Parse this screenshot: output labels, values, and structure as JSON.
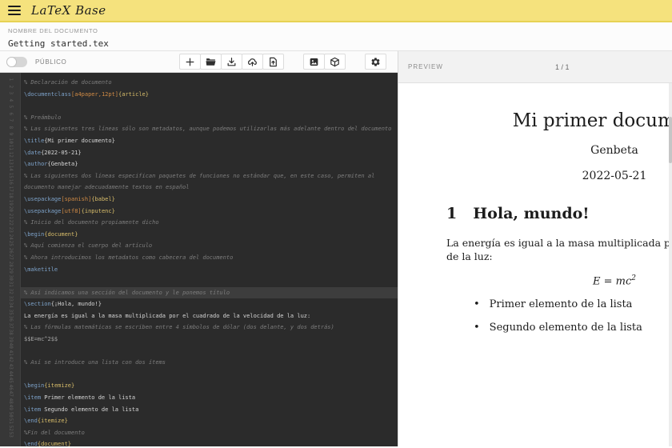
{
  "header": {
    "title": "LaTeX Base"
  },
  "document": {
    "name_label": "NOMBRE DEL DOCUMENTO",
    "name": "Getting started.tex"
  },
  "toolbar": {
    "public_label": "PÚBLICO",
    "public_enabled": false,
    "groups": [
      {
        "items": [
          {
            "name": "new-document",
            "icon": "plus-icon"
          },
          {
            "name": "open-document",
            "icon": "folder-open-icon"
          },
          {
            "name": "download",
            "icon": "download-icon"
          },
          {
            "name": "cloud-upload",
            "icon": "cloud-upload-icon"
          },
          {
            "name": "import-file",
            "icon": "file-upload-icon"
          }
        ]
      },
      {
        "items": [
          {
            "name": "insert-image",
            "icon": "image-icon"
          },
          {
            "name": "packages",
            "icon": "package-icon"
          }
        ]
      },
      {
        "items": [
          {
            "name": "settings",
            "icon": "gear-icon"
          }
        ]
      }
    ]
  },
  "editor": {
    "gutter_line_count": 53,
    "lines": [
      {
        "seg": [
          {
            "c": "comment",
            "t": "% Declaración de documento"
          }
        ]
      },
      {
        "seg": [
          {
            "c": "cmd",
            "t": "\\documentclass"
          },
          {
            "c": "opt",
            "t": "[a4paper,12pt]"
          },
          {
            "c": "env",
            "t": "{article}"
          }
        ]
      },
      {
        "seg": []
      },
      {
        "seg": [
          {
            "c": "comment",
            "t": "% Preámbulo"
          }
        ]
      },
      {
        "seg": [
          {
            "c": "comment",
            "t": "% Las siguientes tres líneas sólo son metadatos, aunque podemos utilizarlas más adelante dentro del documento"
          }
        ]
      },
      {
        "seg": [
          {
            "c": "cmd",
            "t": "\\title"
          },
          {
            "c": "txt",
            "t": "{Mi primer documento}"
          }
        ]
      },
      {
        "seg": [
          {
            "c": "cmd",
            "t": "\\date"
          },
          {
            "c": "txt",
            "t": "{2022-05-21}"
          }
        ]
      },
      {
        "seg": [
          {
            "c": "cmd",
            "t": "\\author"
          },
          {
            "c": "txt",
            "t": "{Genbeta}"
          }
        ]
      },
      {
        "wrap": true,
        "seg": [
          {
            "c": "comment",
            "t": "% Las siguientes dos líneas especifican paquetes de funciones no estándar que, en este caso, permiten al documento manejar adecuadamente textos en español"
          }
        ]
      },
      {
        "seg": [
          {
            "c": "cmd",
            "t": "\\usepackage"
          },
          {
            "c": "opt",
            "t": "[spanish]"
          },
          {
            "c": "env",
            "t": "{babel}"
          }
        ]
      },
      {
        "seg": [
          {
            "c": "cmd",
            "t": "\\usepackage"
          },
          {
            "c": "opt",
            "t": "[utf8]"
          },
          {
            "c": "env",
            "t": "{inputenc}"
          }
        ]
      },
      {
        "seg": [
          {
            "c": "comment",
            "t": "% Inicio del documento propiamente dicho"
          }
        ]
      },
      {
        "seg": [
          {
            "c": "cmd",
            "t": "\\begin"
          },
          {
            "c": "env",
            "t": "{document}"
          }
        ]
      },
      {
        "seg": [
          {
            "c": "comment",
            "t": "% Aquí comienza el cuerpo del artículo"
          }
        ]
      },
      {
        "seg": [
          {
            "c": "comment",
            "t": "% Ahora introducimos los metadatos como cabecera del documento"
          }
        ]
      },
      {
        "seg": [
          {
            "c": "cmd",
            "t": "\\maketitle"
          }
        ]
      },
      {
        "seg": []
      },
      {
        "hl": true,
        "seg": [
          {
            "c": "comment",
            "t": "% Así indicamos una sección del documento y le ponemos título"
          }
        ]
      },
      {
        "seg": [
          {
            "c": "cmd",
            "t": "\\section"
          },
          {
            "c": "txt",
            "t": "{¡Hola, mundo!}"
          }
        ]
      },
      {
        "seg": [
          {
            "c": "txt",
            "t": "La energía es igual a la masa multiplicada por el cuadrado de la velocidad de la luz:"
          }
        ]
      },
      {
        "seg": [
          {
            "c": "comment",
            "t": "% Las fórmulas matemáticas se escriben entre 4 símbolos de dólar (dos delante, y dos detrás)"
          }
        ]
      },
      {
        "seg": [
          {
            "c": "math",
            "t": "$$E=mc^2$$"
          }
        ]
      },
      {
        "seg": []
      },
      {
        "seg": [
          {
            "c": "comment",
            "t": "% Así se introduce una lista con dos ítems"
          }
        ]
      },
      {
        "seg": []
      },
      {
        "seg": [
          {
            "c": "cmd",
            "t": "\\begin"
          },
          {
            "c": "env",
            "t": "{itemize}"
          }
        ]
      },
      {
        "seg": [
          {
            "c": "cmd",
            "t": "\\item"
          },
          {
            "c": "txt",
            "t": " Primer elemento de la lista"
          }
        ]
      },
      {
        "seg": [
          {
            "c": "cmd",
            "t": "\\item"
          },
          {
            "c": "txt",
            "t": " Segundo elemento de la lista"
          }
        ]
      },
      {
        "seg": [
          {
            "c": "cmd",
            "t": "\\end"
          },
          {
            "c": "env",
            "t": "{itemize}"
          }
        ]
      },
      {
        "seg": [
          {
            "c": "comment",
            "t": "%Fin del documento"
          }
        ]
      },
      {
        "seg": [
          {
            "c": "cmd",
            "t": "\\end"
          },
          {
            "c": "env",
            "t": "{document}"
          }
        ]
      }
    ]
  },
  "preview": {
    "label": "PREVIEW",
    "page_indicator": "1 / 1",
    "doc": {
      "title": "Mi primer documento",
      "author": "Genbeta",
      "date": "2022-05-21",
      "section_number": "1",
      "section_title": "Hola, mundo!",
      "paragraph_lines": [
        "La energía es igual a la masa multiplicada por el cuadrado de la velocidad",
        "de la luz:"
      ],
      "formula_base": "E = mc",
      "formula_exponent": "2",
      "bullet_glyph": "•",
      "list_items": [
        "Primer elemento de la lista",
        "Segundo elemento de la lista"
      ]
    }
  },
  "colors": {
    "header_bg": "#f5e27d",
    "editor_bg": "#2b2b2b",
    "editor_highlight_line": "#3d3d3d",
    "syntax_command": "#7da2c9",
    "syntax_optional_arg": "#cf8a45",
    "syntax_environment": "#d8bd6a",
    "syntax_comment": "#7d7d7d",
    "syntax_math": "#a5a5a5",
    "preview_header_bg": "#f2f2f2"
  }
}
